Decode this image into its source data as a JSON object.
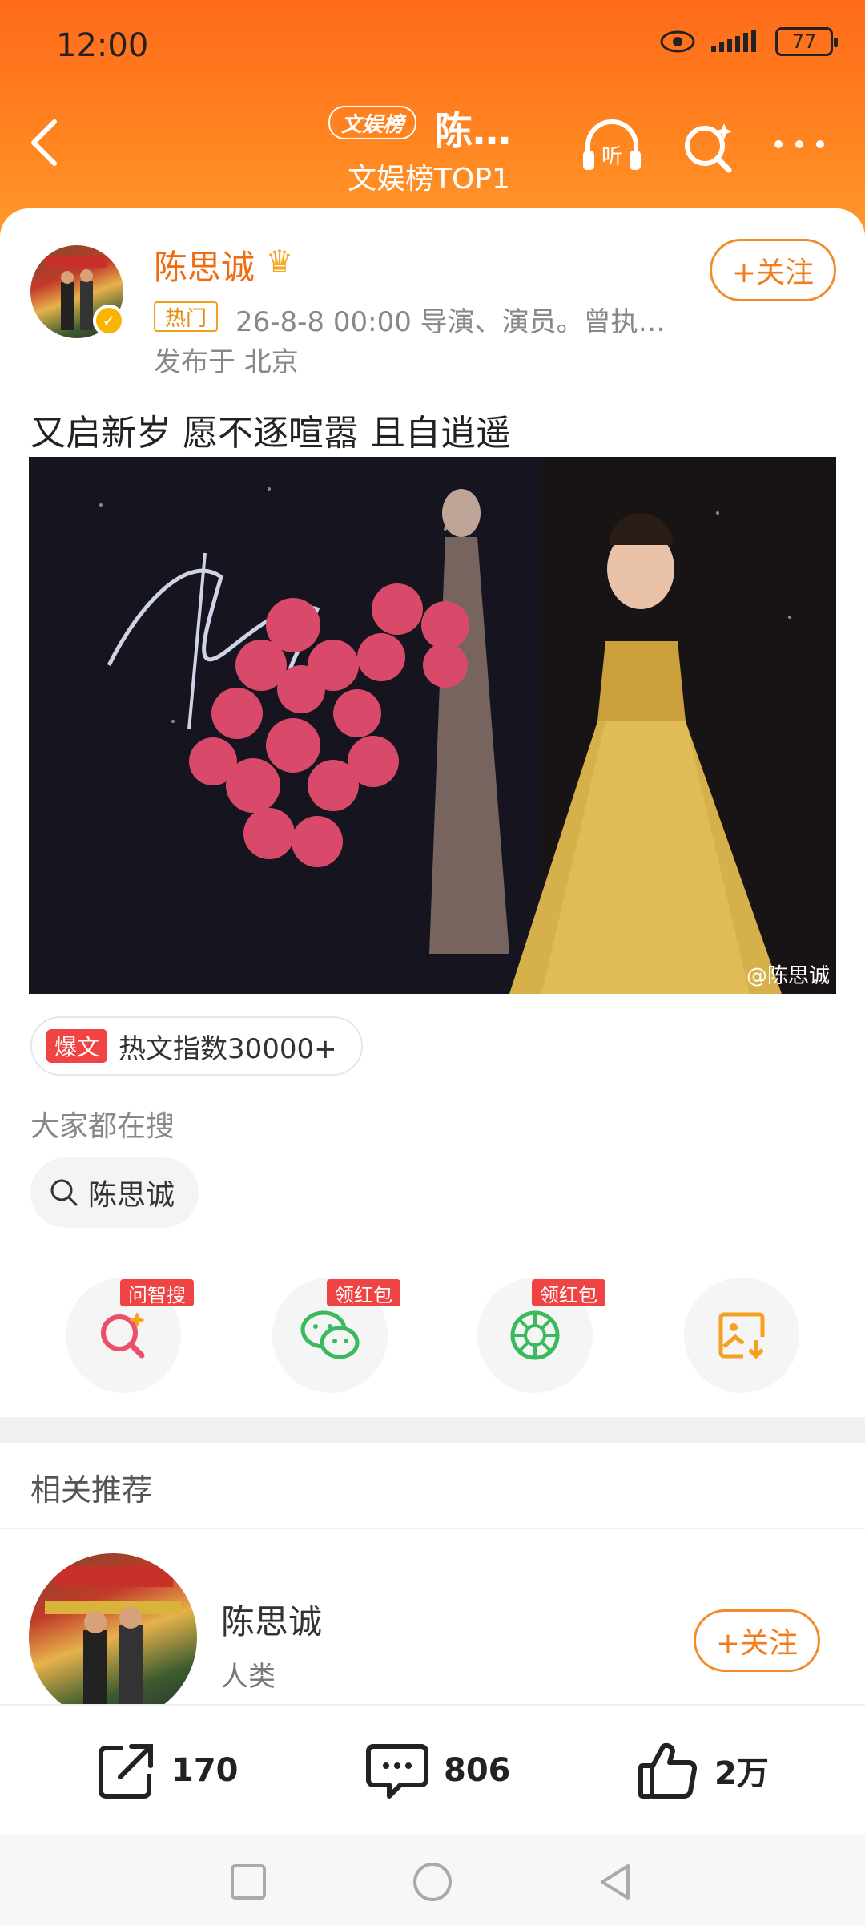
{
  "status_bar": {
    "time": "12:00",
    "battery": "77"
  },
  "header": {
    "tag": "文娱榜",
    "title": "陈…",
    "subtitle": "文娱榜TOP1"
  },
  "post": {
    "author": "陈思诚",
    "hot_tag": "热门",
    "meta": "26-8-8 00:00  导演、演员。曾执…",
    "location": "发布于 北京",
    "follow_label": "+关注",
    "text": "又启新岁 愿不逐喧嚣 且自逍遥",
    "image_watermark": "@陈思诚",
    "hot_badge": "爆文",
    "hot_index": "热文指数30000+"
  },
  "search": {
    "label": "大家都在搜",
    "chip": "陈思诚"
  },
  "actions": [
    {
      "icon": "ai-search-icon",
      "tag": "问智搜"
    },
    {
      "icon": "wechat-icon",
      "tag": "领红包"
    },
    {
      "icon": "moments-icon",
      "tag": "领红包"
    },
    {
      "icon": "save-image-icon",
      "tag": ""
    }
  ],
  "recommend": {
    "title": "相关推荐",
    "name": "陈思诚",
    "subtitle": "人类",
    "follow_label": "+关注"
  },
  "bottom_bar": {
    "share_count": "170",
    "comment_count": "806",
    "like_count": "2万"
  },
  "colors": {
    "accent": "#ff7a1f",
    "follow": "#f07c1b",
    "badge": "#f04444"
  }
}
